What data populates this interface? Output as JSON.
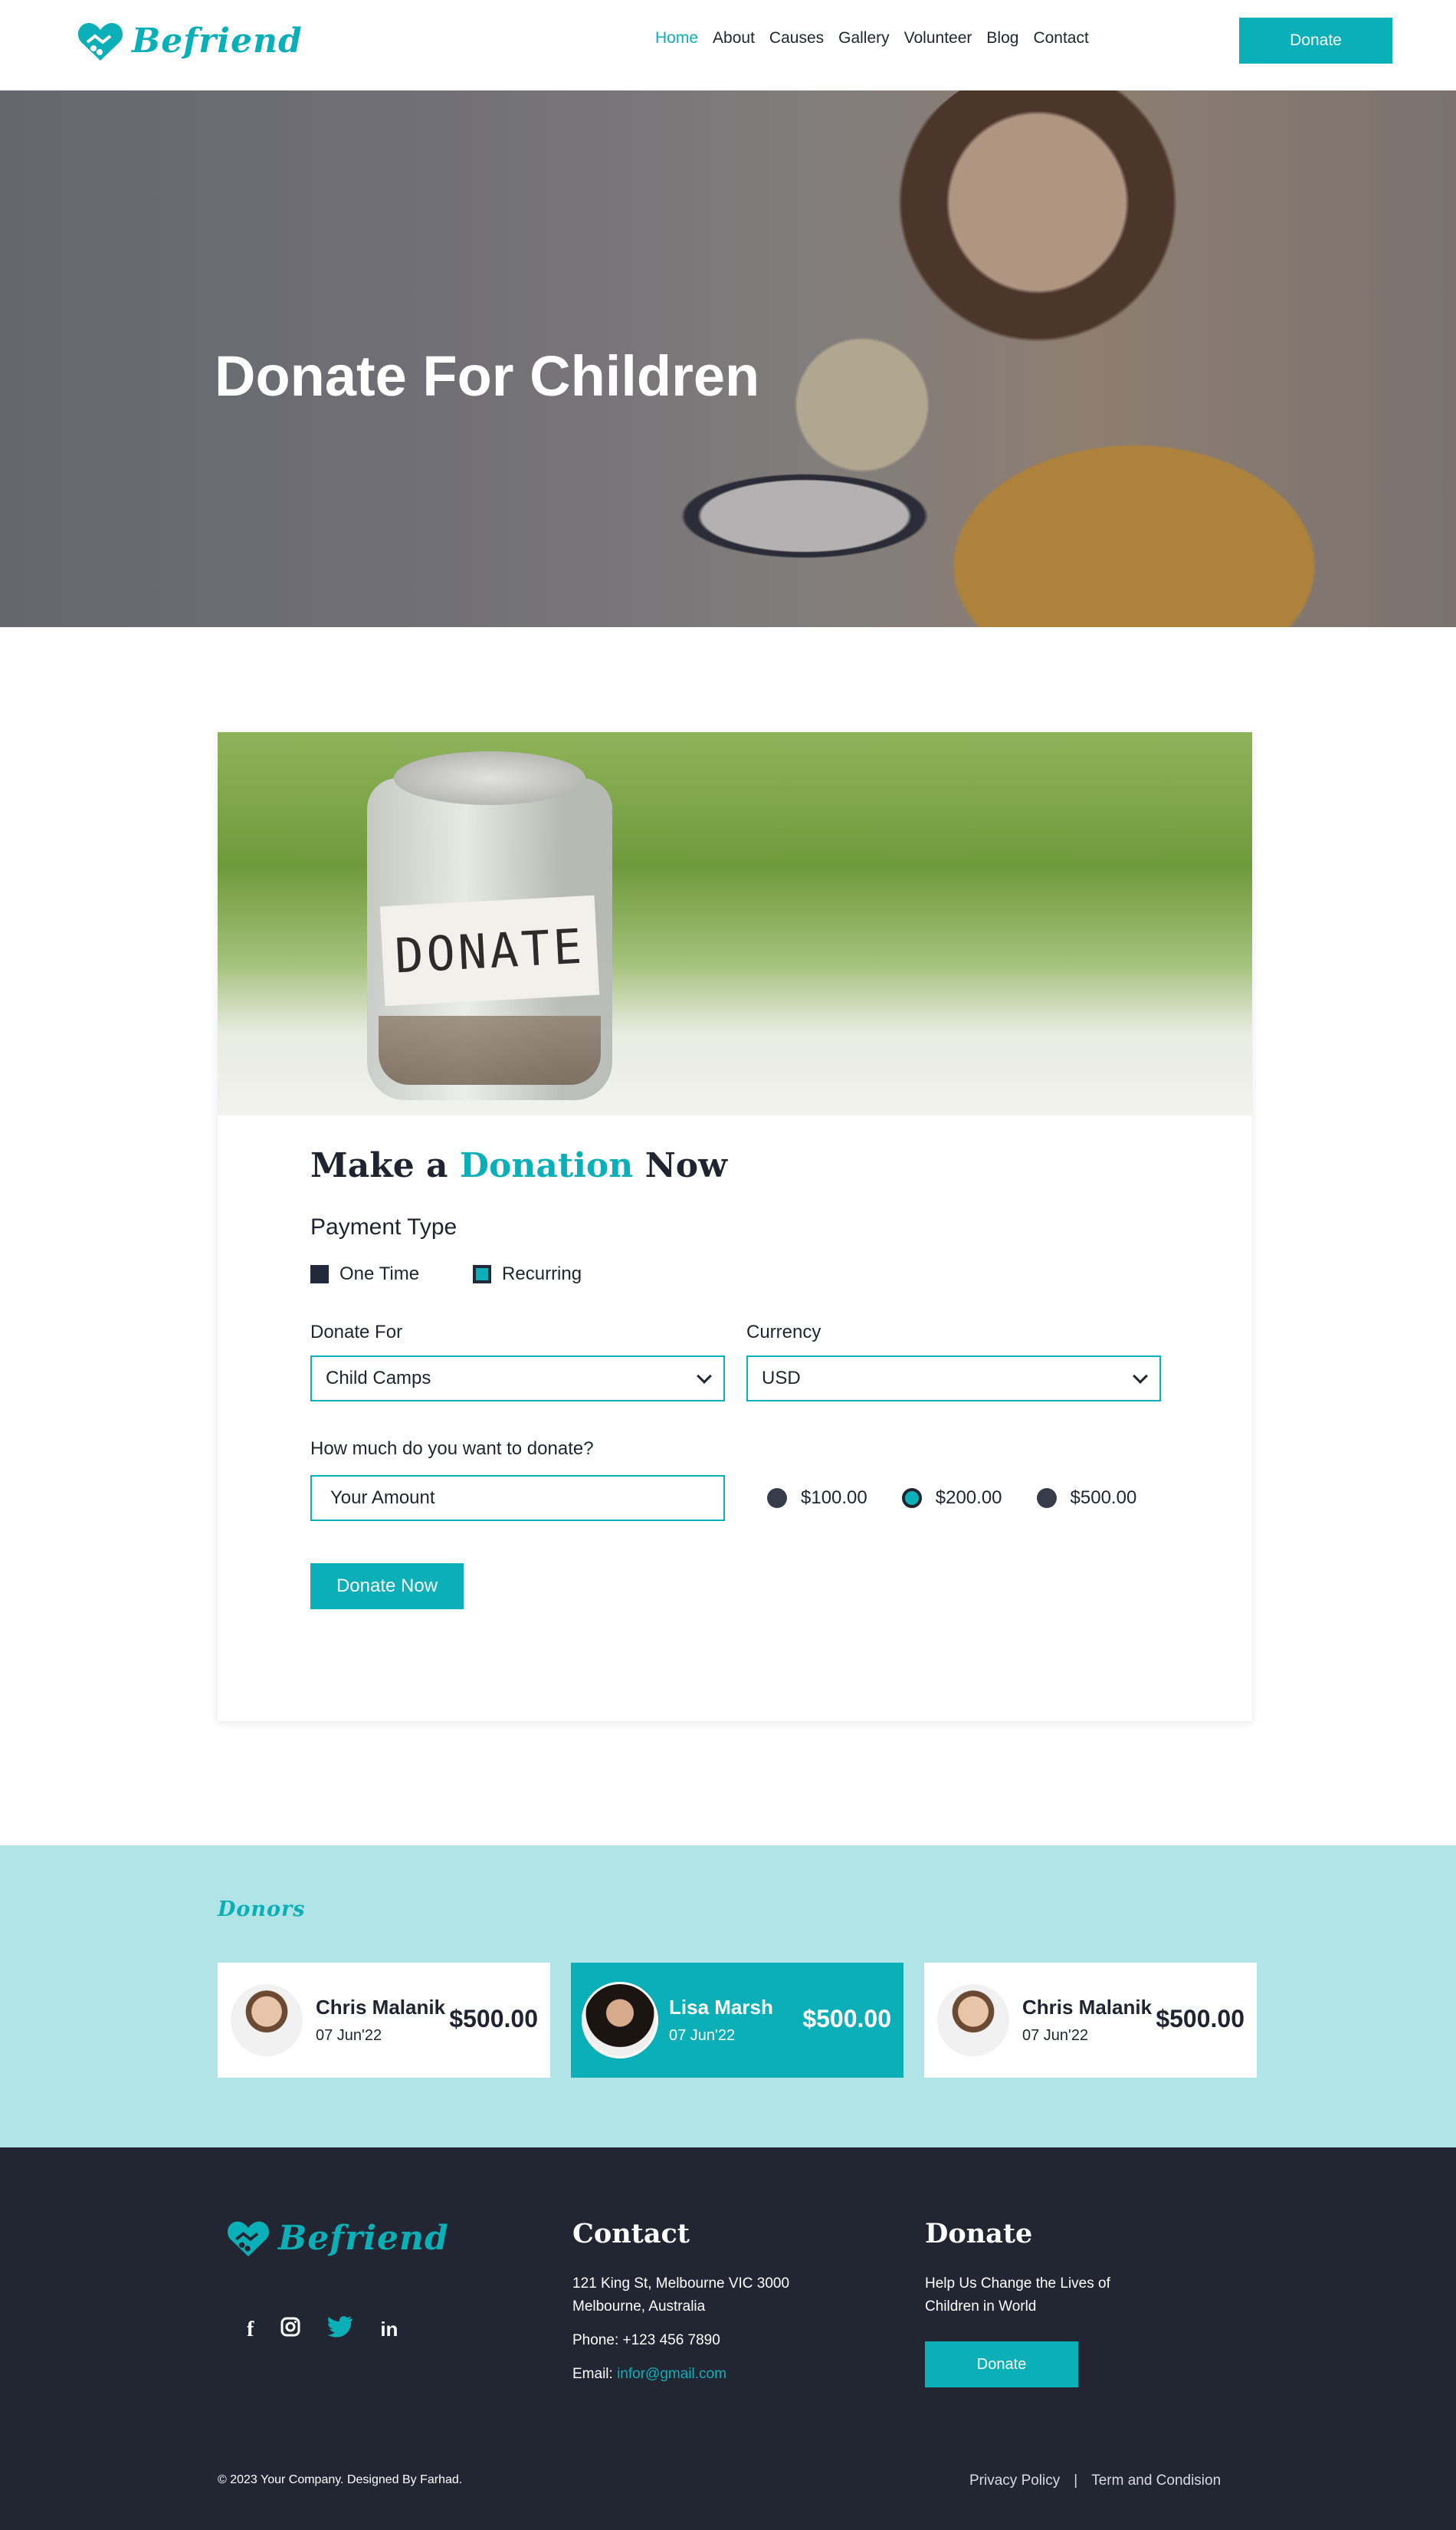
{
  "brand": {
    "name": "Befriend",
    "accent": "#0aafb7",
    "dark": "#212632"
  },
  "nav": {
    "links": [
      "Home",
      "About",
      "Causes",
      "Gallery",
      "Volunteer",
      "Blog",
      "Contact"
    ],
    "active": "Home",
    "donate_label": "Donate"
  },
  "hero": {
    "title_bold": "Donate",
    "title_rest": "For Children"
  },
  "donation": {
    "image_text": "DONATE",
    "title_pre": "Make a",
    "title_accent": "Donation",
    "title_post": "Now",
    "payment_type_label": "Payment Type",
    "payment_options": [
      "One Time",
      "Recurring"
    ],
    "payment_selected": "Recurring",
    "donate_for_label": "Donate For",
    "donate_for_value": "Child Camps",
    "currency_label": "Currency",
    "currency_value": "USD",
    "amount_label": "How much do you want to donate?",
    "amount_placeholder": "Your Amount",
    "amount_options": [
      "$100.00",
      "$200.00",
      "$500.00"
    ],
    "amount_selected": "$200.00",
    "submit_label": "Donate Now"
  },
  "donors": {
    "title": "Donors",
    "items": [
      {
        "name": "Chris Malanik",
        "date": "07 Jun'22",
        "amount": "$500.00",
        "highlight": false
      },
      {
        "name": "Lisa Marsh",
        "date": "07 Jun'22",
        "amount": "$500.00",
        "highlight": true
      },
      {
        "name": "Chris Malanik",
        "date": "07 Jun'22",
        "amount": "$500.00",
        "highlight": false
      }
    ]
  },
  "footer": {
    "social_icons": [
      "facebook-icon",
      "instagram-icon",
      "twitter-icon",
      "linkedin-icon"
    ],
    "contact": {
      "heading": "Contact",
      "address_line1": "121 King St, Melbourne VIC 3000",
      "address_line2": "Melbourne, Australia",
      "phone": "Phone: +123 456 7890",
      "email_label": "Email:",
      "email": "infor@gmail.com"
    },
    "donate": {
      "heading": "Donate",
      "text_line1": "Help Us Change the Lives of",
      "text_line2": "Children in World",
      "button_label": "Donate"
    },
    "copyright": "© 2023 Your Company. Designed By Farhad.",
    "links": [
      "Privacy Policy",
      "Term and Condision"
    ],
    "separator": "|"
  }
}
